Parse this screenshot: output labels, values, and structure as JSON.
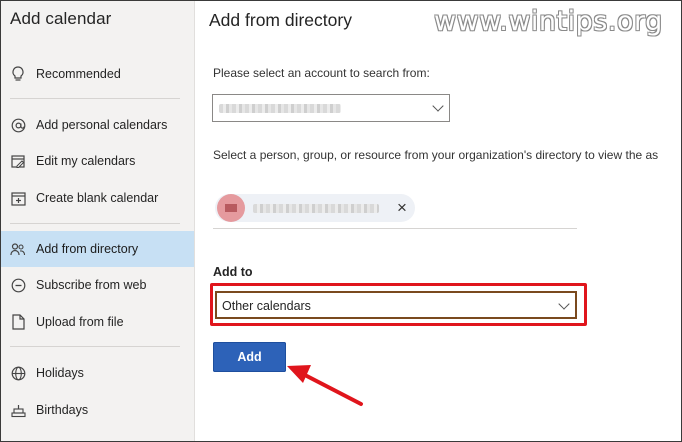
{
  "sidebar": {
    "title": "Add calendar",
    "items": [
      {
        "label": "Recommended",
        "icon": "lightbulb-icon"
      },
      {
        "label": "Add personal calendars",
        "icon": "at-sign-icon"
      },
      {
        "label": "Edit my calendars",
        "icon": "edit-calendar-icon"
      },
      {
        "label": "Create blank calendar",
        "icon": "calendar-add-icon"
      },
      {
        "label": "Add from directory",
        "icon": "people-icon"
      },
      {
        "label": "Subscribe from web",
        "icon": "link-icon"
      },
      {
        "label": "Upload from file",
        "icon": "document-icon"
      },
      {
        "label": "Holidays",
        "icon": "globe-icon"
      },
      {
        "label": "Birthdays",
        "icon": "cake-icon"
      }
    ],
    "active_index": 4
  },
  "main": {
    "title": "Add from directory",
    "account_label": "Please select an account to search from:",
    "directory_label": "Select a person, group, or resource from your organization's directory to view the as",
    "add_to_label": "Add to",
    "add_to_value": "Other calendars",
    "add_button": "Add"
  },
  "watermark": "www.wintips.org",
  "colors": {
    "accent": "#2d62b8",
    "active_nav": "#c7e0f4",
    "highlight_box": "#e0151c"
  }
}
